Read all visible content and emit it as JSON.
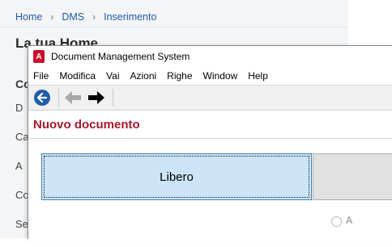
{
  "background_page": {
    "breadcrumb": [
      "Home",
      "DMS",
      "Inserimento"
    ],
    "title": "La tua Home",
    "side_heading": "Co",
    "side_items": [
      "D",
      "Ca",
      "A",
      "Co",
      "Se"
    ]
  },
  "window": {
    "app_icon_letter": "A",
    "title": "Document Management System",
    "menu": [
      "File",
      "Modifica",
      "Vai",
      "Azioni",
      "Righe",
      "Window",
      "Help"
    ],
    "toolbar": [
      "back-circle-icon",
      "back-arrow-icon",
      "forward-arrow-icon"
    ],
    "section_title": "Nuovo documento",
    "buttons": {
      "libero": "Libero"
    },
    "radio_label": "A"
  },
  "colors": {
    "accent_red": "#a3192a",
    "selected_button_bg": "#cce4f7",
    "link_blue": "#1f5aa8"
  }
}
